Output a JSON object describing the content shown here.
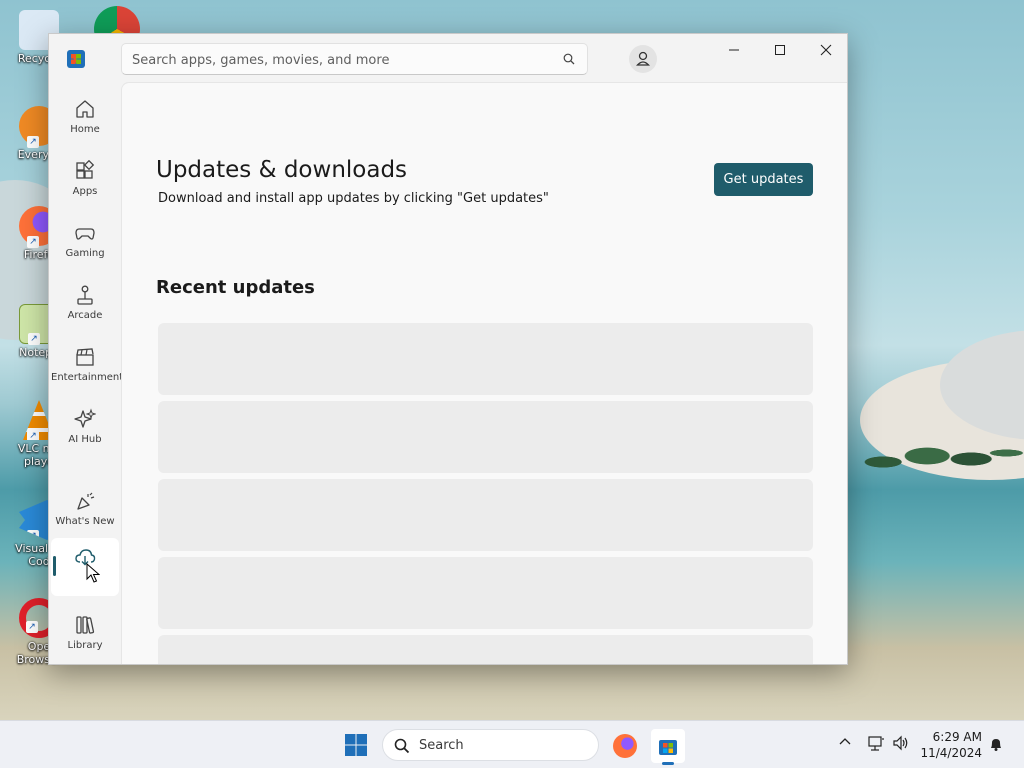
{
  "desktop": {
    "icons": [
      {
        "label": "Recycle",
        "color": "#9fc7e8"
      },
      {
        "label": "Everyth",
        "color": "#f08a24"
      },
      {
        "label": "Firefo",
        "color": "#ff7139"
      },
      {
        "label": "Notepa",
        "color": "#8fbf4a"
      },
      {
        "label": "VLC me playe",
        "color": "#f28c00"
      },
      {
        "label": "Visual St Cod",
        "color": "#2a8ad8"
      },
      {
        "label": "Ope Browser",
        "color": "#e0202a"
      }
    ]
  },
  "store": {
    "search": {
      "placeholder": "Search apps, games, movies, and more",
      "value": ""
    },
    "sidebar": {
      "items": [
        {
          "label": "Home",
          "icon": "home-icon"
        },
        {
          "label": "Apps",
          "icon": "apps-icon"
        },
        {
          "label": "Gaming",
          "icon": "gamepad-icon"
        },
        {
          "label": "Arcade",
          "icon": "joystick-icon"
        },
        {
          "label": "Entertainment",
          "icon": "clapper-icon"
        },
        {
          "label": "AI Hub",
          "icon": "sparkle-icon"
        },
        {
          "label": "What's New",
          "icon": "party-icon"
        },
        {
          "label": "",
          "icon": "cloud-download-icon"
        },
        {
          "label": "Library",
          "icon": "library-icon"
        }
      ]
    },
    "page": {
      "title": "Updates & downloads",
      "subtitle": "Download and install app updates by clicking \"Get updates\"",
      "get_updates_label": "Get updates",
      "recent_title": "Recent updates"
    }
  },
  "taskbar": {
    "search_label": "Search",
    "time": "6:29 AM",
    "date": "11/4/2024"
  },
  "colors": {
    "accent": "#1f5c6b",
    "windows_blue": "#1f6fb8"
  }
}
